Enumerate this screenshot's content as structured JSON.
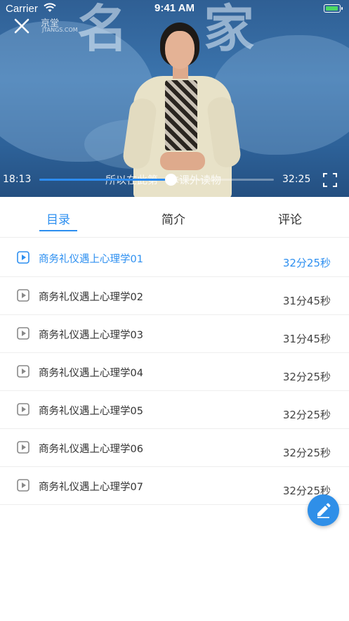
{
  "status_bar": {
    "carrier": "Carrier",
    "time": "9:41 AM"
  },
  "video": {
    "subtitle": "所以在此第一本课外读物",
    "current_time": "18:13",
    "total_time": "32:25",
    "progress_fraction": 0.56,
    "logo_text": "京堂",
    "logo_url": "JTANGS.COM"
  },
  "tabs": [
    {
      "label": "目录",
      "active": true
    },
    {
      "label": "简介",
      "active": false
    },
    {
      "label": "评论",
      "active": false
    }
  ],
  "lessons": [
    {
      "title": "商务礼仪遇上心理学01",
      "duration": "32分25秒",
      "active": true
    },
    {
      "title": "商务礼仪遇上心理学02",
      "duration": "31分45秒",
      "active": false
    },
    {
      "title": "商务礼仪遇上心理学03",
      "duration": "31分45秒",
      "active": false
    },
    {
      "title": "商务礼仪遇上心理学04",
      "duration": "32分25秒",
      "active": false
    },
    {
      "title": "商务礼仪遇上心理学05",
      "duration": "32分25秒",
      "active": false
    },
    {
      "title": "商务礼仪遇上心理学06",
      "duration": "32分25秒",
      "active": false
    },
    {
      "title": "商务礼仪遇上心理学07",
      "duration": "32分25秒",
      "active": false
    }
  ],
  "colors": {
    "accent": "#2d8ff0",
    "fab": "#2f8fe8"
  },
  "icons": {
    "close": "close-icon",
    "fullscreen": "fullscreen-icon",
    "play": "play-icon",
    "edit": "pencil-icon"
  }
}
